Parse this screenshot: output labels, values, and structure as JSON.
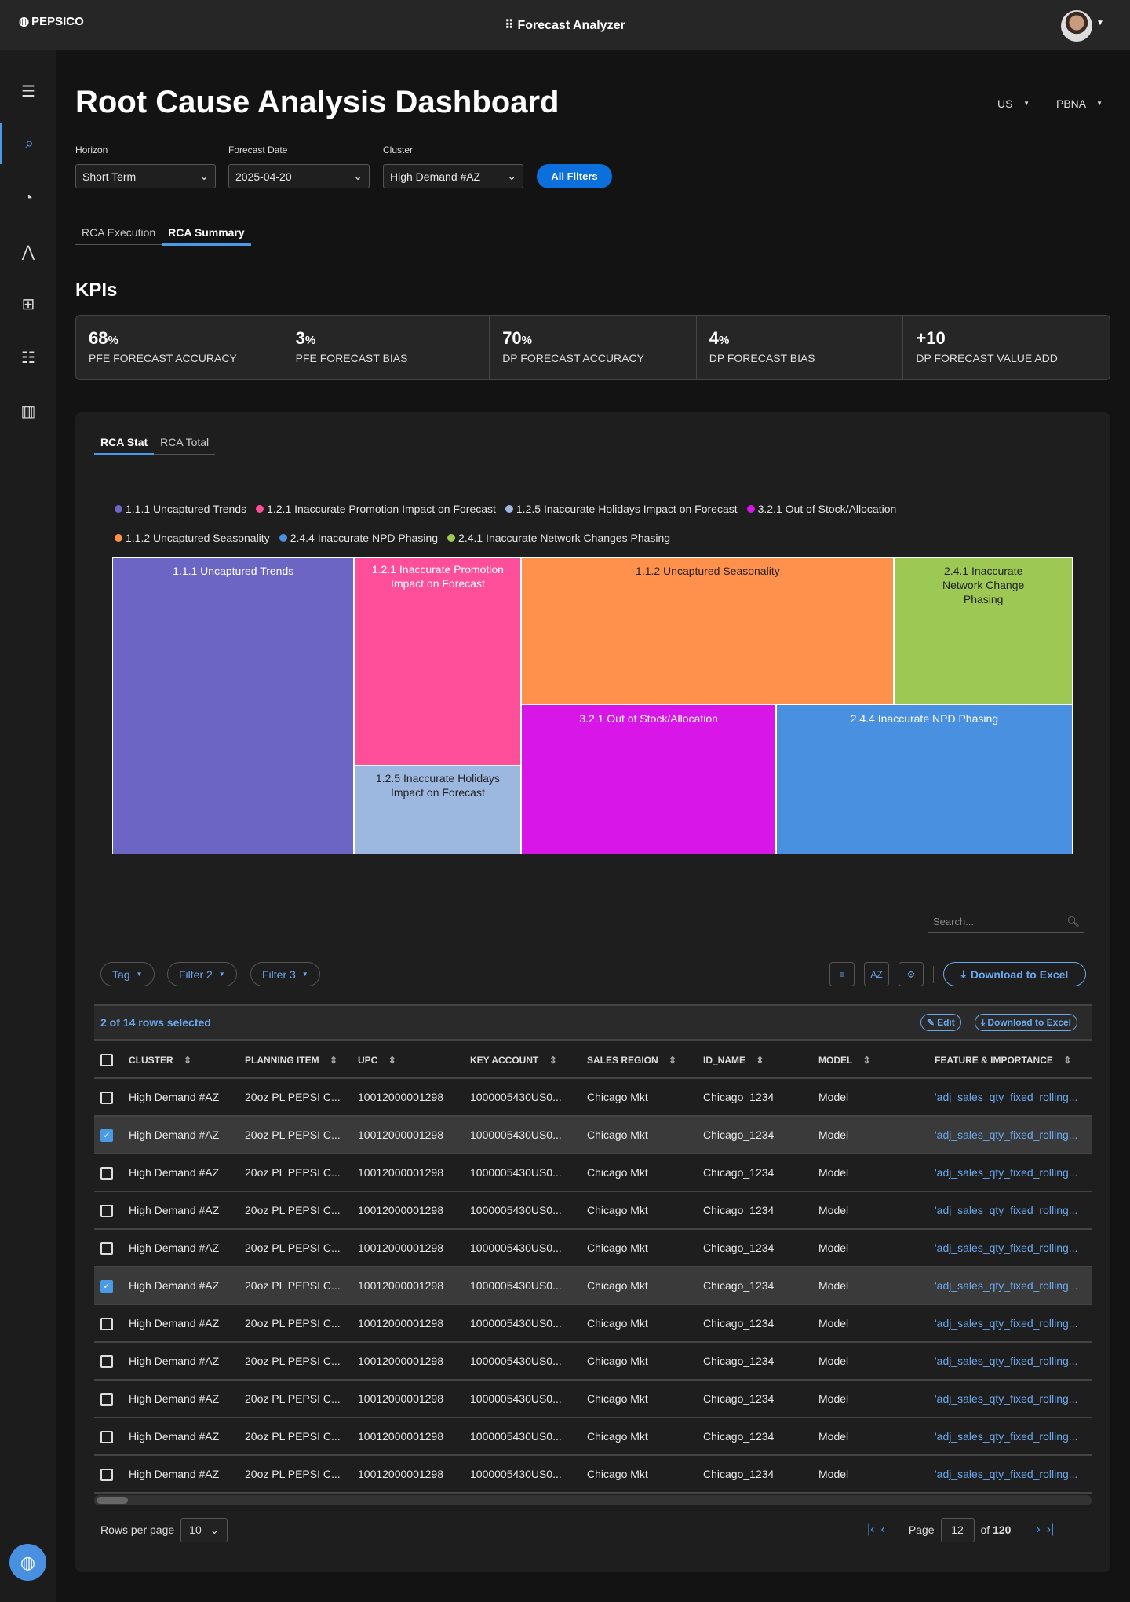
{
  "header": {
    "brand": "PEPSICO",
    "app_title": "Forecast Analyzer"
  },
  "page": {
    "title": "Root Cause Analysis Dashboard",
    "region_select": "US",
    "division_select": "PBNA"
  },
  "filters": [
    {
      "label": "Horizon",
      "value": "Short Term"
    },
    {
      "label": "Forecast Date",
      "value": "2025-04-20"
    },
    {
      "label": "Cluster",
      "value": "High Demand #AZ"
    }
  ],
  "all_filters_label": "All Filters",
  "tabs": [
    "RCA Execution",
    "RCA Summary"
  ],
  "kpi_title": "KPIs",
  "kpis": [
    {
      "value": "68",
      "unit": "%",
      "label": "PFE FORECAST ACCURACY"
    },
    {
      "value": "3",
      "unit": "%",
      "label": "PFE FORECAST BIAS"
    },
    {
      "value": "70",
      "unit": "%",
      "label": "DP FORECAST ACCURACY"
    },
    {
      "value": "4",
      "unit": "%",
      "label": "DP FORECAST BIAS"
    },
    {
      "value": "+10",
      "unit": "",
      "label": "DP FORECAST VALUE ADD"
    }
  ],
  "rca_tabs": [
    "RCA Stat",
    "RCA Total"
  ],
  "chart_data": {
    "type": "treemap",
    "legend": [
      {
        "label": "1.1.1 Uncaptured Trends",
        "color": "#6b66c4"
      },
      {
        "label": "1.2.1 Inaccurate Promotion Impact on Forecast",
        "color": "#ff4f9a"
      },
      {
        "label": "1.2.5 Inaccurate Holidays Impact on Forecast",
        "color": "#9db8e0"
      },
      {
        "label": "3.2.1 Out of Stock/Allocation",
        "color": "#d916e8"
      },
      {
        "label": "1.1.2 Uncaptured Seasonality",
        "color": "#ff914d"
      },
      {
        "label": "2.4.4 Inaccurate NPD Phasing",
        "color": "#4a90e0"
      },
      {
        "label": "2.4.1 Inaccurate Network Changes Phasing",
        "color": "#9dc854"
      }
    ],
    "nodes": [
      {
        "label": "1.1.1 Uncaptured Trends",
        "share": 25.2,
        "color": "#6b66c4"
      },
      {
        "label": "1.2.1 Inaccurate Promotion Impact on Forecast",
        "share": 12.2,
        "color": "#ff4f9a"
      },
      {
        "label": "1.2.5 Inaccurate Holidays Impact on Forecast",
        "share": 5.2,
        "color": "#9db8e0"
      },
      {
        "label": "1.1.2 Uncaptured Seasonality",
        "share": 19.3,
        "color": "#ff914d"
      },
      {
        "label": "2.4.1 Inaccurate Network Change Phasing",
        "share": 9.2,
        "color": "#9dc854"
      },
      {
        "label": "3.2.1 Out of Stock/Allocation",
        "share": 13.3,
        "color": "#d916e8"
      },
      {
        "label": "2.4.4 Inaccurate NPD Phasing",
        "share": 15.6,
        "color": "#4a90e0"
      }
    ]
  },
  "table": {
    "search_placeholder": "Search...",
    "chips": [
      "Tag",
      "Filter 2",
      "Filter 3"
    ],
    "download_label": "Download to Excel",
    "selection_text": "2 of 14 rows selected",
    "edit_label": "Edit",
    "columns": [
      "CLUSTER",
      "PLANNING ITEM",
      "UPC",
      "KEY ACCOUNT",
      "SALES REGION",
      "ID_NAME",
      "MODEL",
      "FEATURE & IMPORTANCE"
    ],
    "rows": [
      {
        "selected": false,
        "cells": [
          "High Demand #AZ",
          "20oz PL PEPSI C...",
          "10012000001298",
          "1000005430US0...",
          "Chicago Mkt",
          "Chicago_1234",
          "Model",
          "'adj_sales_qty_fixed_rolling..."
        ]
      },
      {
        "selected": true,
        "cells": [
          "High Demand #AZ",
          "20oz PL PEPSI C...",
          "10012000001298",
          "1000005430US0...",
          "Chicago Mkt",
          "Chicago_1234",
          "Model",
          "'adj_sales_qty_fixed_rolling..."
        ]
      },
      {
        "selected": false,
        "cells": [
          "High Demand #AZ",
          "20oz PL PEPSI C...",
          "10012000001298",
          "1000005430US0...",
          "Chicago Mkt",
          "Chicago_1234",
          "Model",
          "'adj_sales_qty_fixed_rolling..."
        ]
      },
      {
        "selected": false,
        "cells": [
          "High Demand #AZ",
          "20oz PL PEPSI C...",
          "10012000001298",
          "1000005430US0...",
          "Chicago Mkt",
          "Chicago_1234",
          "Model",
          "'adj_sales_qty_fixed_rolling..."
        ]
      },
      {
        "selected": false,
        "cells": [
          "High Demand #AZ",
          "20oz PL PEPSI C...",
          "10012000001298",
          "1000005430US0...",
          "Chicago Mkt",
          "Chicago_1234",
          "Model",
          "'adj_sales_qty_fixed_rolling..."
        ]
      },
      {
        "selected": true,
        "cells": [
          "High Demand #AZ",
          "20oz PL PEPSI C...",
          "10012000001298",
          "1000005430US0...",
          "Chicago Mkt",
          "Chicago_1234",
          "Model",
          "'adj_sales_qty_fixed_rolling..."
        ]
      },
      {
        "selected": false,
        "cells": [
          "High Demand #AZ",
          "20oz PL PEPSI C...",
          "10012000001298",
          "1000005430US0...",
          "Chicago Mkt",
          "Chicago_1234",
          "Model",
          "'adj_sales_qty_fixed_rolling..."
        ]
      },
      {
        "selected": false,
        "cells": [
          "High Demand #AZ",
          "20oz PL PEPSI C...",
          "10012000001298",
          "1000005430US0...",
          "Chicago Mkt",
          "Chicago_1234",
          "Model",
          "'adj_sales_qty_fixed_rolling..."
        ]
      },
      {
        "selected": false,
        "cells": [
          "High Demand #AZ",
          "20oz PL PEPSI C...",
          "10012000001298",
          "1000005430US0...",
          "Chicago Mkt",
          "Chicago_1234",
          "Model",
          "'adj_sales_qty_fixed_rolling..."
        ]
      },
      {
        "selected": false,
        "cells": [
          "High Demand #AZ",
          "20oz PL PEPSI C...",
          "10012000001298",
          "1000005430US0...",
          "Chicago Mkt",
          "Chicago_1234",
          "Model",
          "'adj_sales_qty_fixed_rolling..."
        ]
      },
      {
        "selected": false,
        "cells": [
          "High Demand #AZ",
          "20oz PL PEPSI C...",
          "10012000001298",
          "1000005430US0...",
          "Chicago Mkt",
          "Chicago_1234",
          "Model",
          "'adj_sales_qty_fixed_rolling..."
        ]
      }
    ]
  },
  "pagination": {
    "rows_per_page_label": "Rows per page",
    "rows_per_page": "10",
    "page_label": "Page",
    "page": "12",
    "of_label": "of",
    "total_pages": "120"
  }
}
